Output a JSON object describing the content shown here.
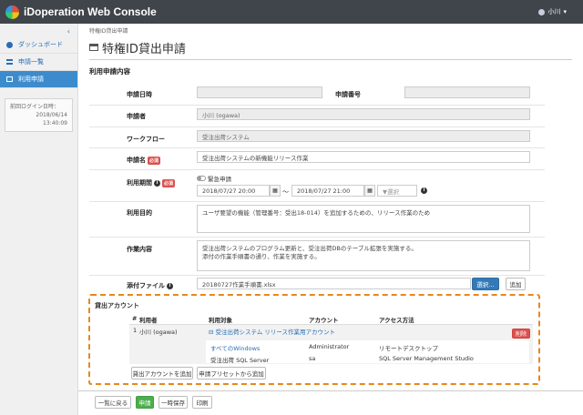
{
  "app": {
    "title": "iDoperation Web Console",
    "user": "小川"
  },
  "sidebar": {
    "collapse": "‹",
    "items": [
      {
        "label": "ダッシュボード",
        "icon": "palette-icon"
      },
      {
        "label": "申請一覧",
        "icon": "list-icon"
      },
      {
        "label": "利用申請",
        "icon": "monitor-icon",
        "active": true
      }
    ],
    "last_login_label": "前回ログイン日時：",
    "last_login_value": "2018/06/14 13:40:09"
  },
  "breadcrumb": "特権ID貸出申請",
  "page_title": "特権ID貸出申請",
  "section_title": "利用申請内容",
  "form": {
    "app_datetime_label": "申請日時",
    "app_datetime_value": "",
    "app_number_label": "申請番号",
    "app_number_value": "",
    "applicant_label": "申請者",
    "applicant_value": "小川 (ogawa)",
    "workflow_label": "ワークフロー",
    "workflow_value": "受注出荷システム",
    "app_name_label": "申請名",
    "required": "必須",
    "app_name_value": "受注出荷システムの新機能リリース作業",
    "period_label": "利用期間",
    "urgent_label": "緊急申請",
    "period_from": "2018/07/27 20:00",
    "period_sep": "〜",
    "period_to": "2018/07/27 21:00",
    "period_select": "▼選択",
    "purpose_label": "利用目的",
    "purpose_value": "ユーザ要望の機能（管理番号：受出18-014）を追加するための、リリース作業のため",
    "work_label": "作業内容",
    "work_line1": "受注出荷システムのプログラム更新と、受注出荷DBのテーブル拡張を実施する。",
    "work_line2": "添付の作業手順書の通り、作業を実施する。",
    "attach_label": "添付ファイル",
    "attach_value": "20180727作業手順書.xlsx",
    "select_button": "選択...",
    "add_button": "追加"
  },
  "accounts": {
    "title": "貸出アカウント",
    "headers": [
      "#",
      "利用者",
      "利用対象",
      "アカウント",
      "アクセス方法"
    ],
    "row_num": "1",
    "user": "小川 (ogawa)",
    "group": "⊟ 受注出荷システム リリース作業用アカウント",
    "delete_button": "削除",
    "items": [
      {
        "target": "すべてのWindows",
        "account": "Administrator",
        "access": "リモートデスクトップ"
      },
      {
        "target": "受注出荷 SQL Server",
        "account": "sa",
        "access": "SQL Server Management Studio"
      }
    ],
    "add_account_button": "貸出アカウントを追加",
    "add_preset_button": "申請プリセットから追加"
  },
  "footer": {
    "back": "一覧に戻る",
    "apply": "申請",
    "save": "一時保存",
    "print": "印刷"
  }
}
